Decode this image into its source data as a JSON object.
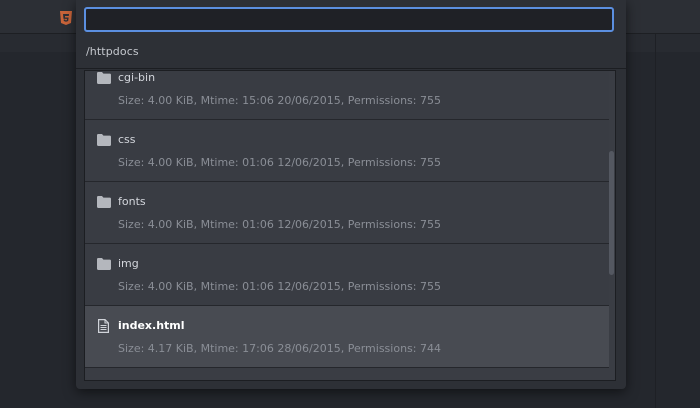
{
  "palette": {
    "query_value": "",
    "current_path": "/httpdocs",
    "items": [
      {
        "type": "folder",
        "name": "cgi-bin",
        "meta": "Size: 4.00 KiB, Mtime: 15:06 20/06/2015, Permissions: 755",
        "selected": false
      },
      {
        "type": "folder",
        "name": "css",
        "meta": "Size: 4.00 KiB, Mtime: 01:06 12/06/2015, Permissions: 755",
        "selected": false
      },
      {
        "type": "folder",
        "name": "fonts",
        "meta": "Size: 4.00 KiB, Mtime: 01:06 12/06/2015, Permissions: 755",
        "selected": false
      },
      {
        "type": "folder",
        "name": "img",
        "meta": "Size: 4.00 KiB, Mtime: 01:06 12/06/2015, Permissions: 755",
        "selected": false
      },
      {
        "type": "file",
        "name": "index.html",
        "meta": "Size: 4.17 KiB, Mtime: 17:06 28/06/2015, Permissions: 744",
        "selected": true
      }
    ]
  },
  "icons": {
    "tab": "html5-icon",
    "folder": "folder-icon",
    "file": "file-icon"
  },
  "colors": {
    "input_focus_border": "#5b8fe0",
    "tab_icon": "#c9643a",
    "selected_row": "#484b52"
  }
}
